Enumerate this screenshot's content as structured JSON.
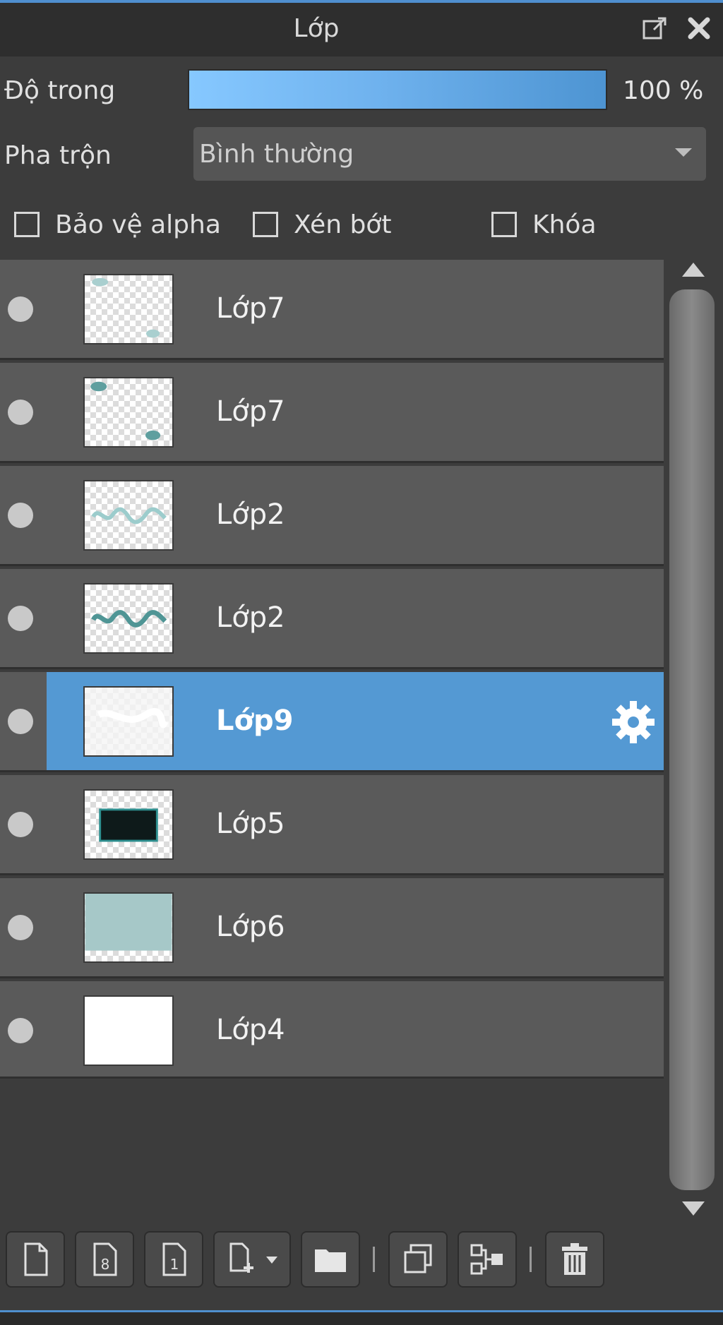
{
  "panel": {
    "title": "Lớp"
  },
  "opacity": {
    "label": "Độ trong",
    "value_text": "100 %",
    "value_percent": 100
  },
  "blend": {
    "label": "Pha trộn",
    "selected": "Bình thường"
  },
  "checkboxes": {
    "protect_alpha": {
      "label": "Bảo vệ alpha",
      "checked": false
    },
    "clipping": {
      "label": "Xén bớt",
      "checked": false
    },
    "lock": {
      "label": "Khóa",
      "checked": false
    }
  },
  "layers": [
    {
      "name": "Lớp7",
      "selected": false,
      "thumb": "dots-light"
    },
    {
      "name": "Lớp7",
      "selected": false,
      "thumb": "dots-dark"
    },
    {
      "name": "Lớp2",
      "selected": false,
      "thumb": "script-light"
    },
    {
      "name": "Lớp2",
      "selected": false,
      "thumb": "script-dark"
    },
    {
      "name": "Lớp9",
      "selected": true,
      "thumb": "white-scribble"
    },
    {
      "name": "Lớp5",
      "selected": false,
      "thumb": "dark-frame"
    },
    {
      "name": "Lớp6",
      "selected": false,
      "thumb": "teal-fill"
    },
    {
      "name": "Lớp4",
      "selected": false,
      "thumb": "white-fill"
    }
  ],
  "toolbar": [
    "new-layer-icon",
    "new-8bit-layer-icon",
    "new-1bit-layer-icon",
    "add-layer-menu-icon",
    "folder-icon",
    "duplicate-layer-icon",
    "merge-down-icon",
    "delete-layer-icon"
  ],
  "colors": {
    "accent": "#5499d3",
    "panel": "#3c3c3c",
    "row": "#5a5a5a"
  }
}
